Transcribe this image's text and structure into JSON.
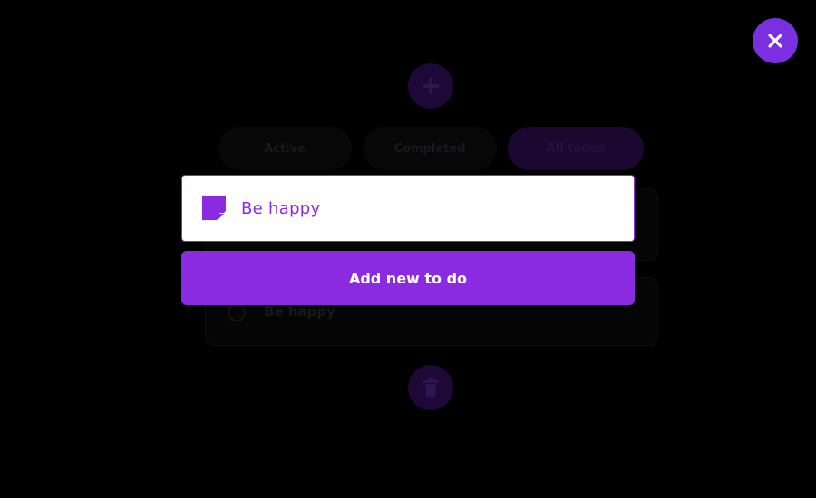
{
  "colors": {
    "accent": "#8a2be2",
    "close_bg": "#7a2fe0",
    "backdrop": "#000000"
  },
  "background_app": {
    "add_icon": "plus-icon",
    "filters": [
      {
        "label": "Active"
      },
      {
        "label": "Completed"
      },
      {
        "label": "All todos",
        "selected": true
      }
    ],
    "todos": [
      {
        "text": ""
      },
      {
        "text": "Be happy"
      }
    ],
    "delete_icon": "trash-icon"
  },
  "modal": {
    "close_icon": "close-icon",
    "input": {
      "icon": "sticky-note-icon",
      "value": "Be happy"
    },
    "submit_label": "Add new to do"
  }
}
